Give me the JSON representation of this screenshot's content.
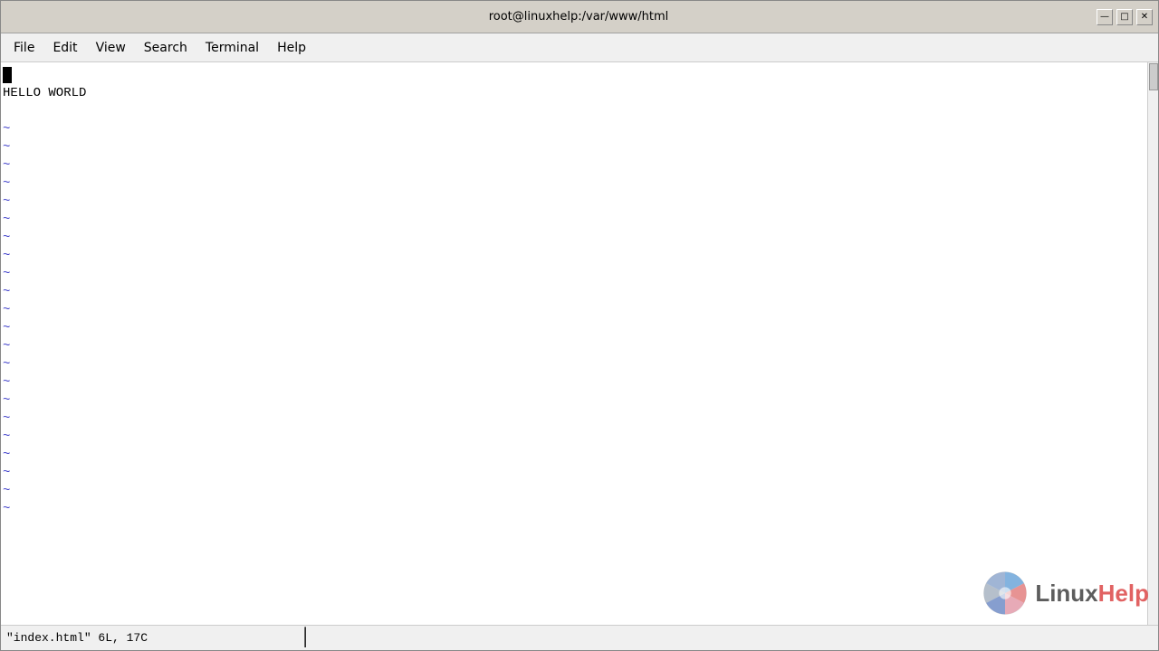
{
  "window": {
    "title": "root@linuxhelp:/var/www/html",
    "controls": {
      "minimize": "—",
      "maximize": "□",
      "close": "✕"
    }
  },
  "menu": {
    "items": [
      "File",
      "Edit",
      "View",
      "Search",
      "Terminal",
      "Help"
    ]
  },
  "terminal": {
    "cursor_line": "",
    "content_line": "HELLO WORLD",
    "tilde_count": 22
  },
  "status_bar": {
    "text": "\"index.html\" 6L, 17C"
  },
  "watermark": {
    "linux": "Linux",
    "help": "Help"
  }
}
